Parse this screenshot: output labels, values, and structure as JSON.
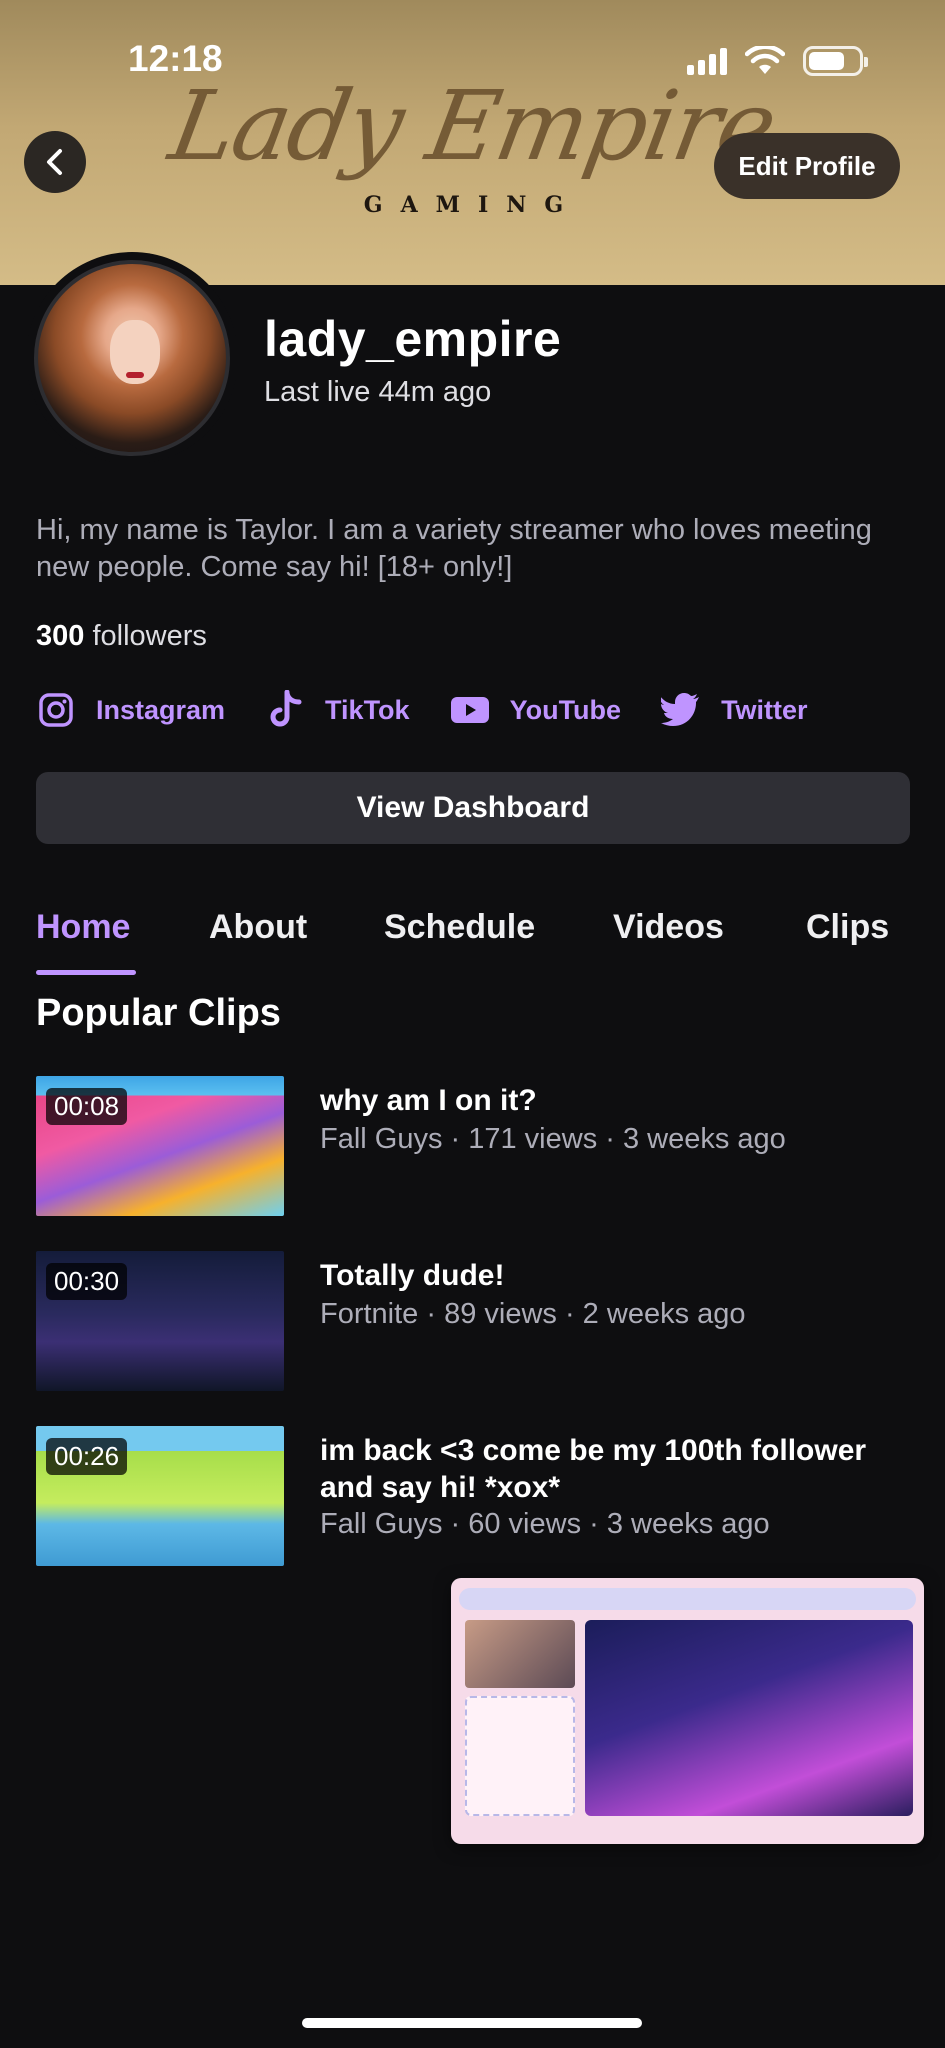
{
  "status_bar": {
    "time": "12:18",
    "battery_level": 0.72
  },
  "banner": {
    "logo_script": "Lady Empire",
    "logo_sub": "GAMING"
  },
  "nav": {
    "back_icon": "chevron-left-icon",
    "edit_profile_label": "Edit Profile"
  },
  "profile": {
    "username": "lady_empire",
    "last_live": "Last live 44m ago",
    "bio": "Hi, my name is Taylor. I am a variety streamer who loves meeting new people.  Come say hi!  [18+ only!]",
    "followers_count": "300",
    "followers_label": "followers"
  },
  "socials": [
    {
      "name": "Instagram",
      "icon": "instagram-icon"
    },
    {
      "name": "TikTok",
      "icon": "tiktok-icon"
    },
    {
      "name": "YouTube",
      "icon": "youtube-icon"
    },
    {
      "name": "Twitter",
      "icon": "twitter-icon"
    }
  ],
  "dashboard_button_label": "View Dashboard",
  "tabs": [
    {
      "label": "Home",
      "active": true
    },
    {
      "label": "About",
      "active": false
    },
    {
      "label": "Schedule",
      "active": false
    },
    {
      "label": "Videos",
      "active": false
    },
    {
      "label": "Clips",
      "active": false
    }
  ],
  "section_title": "Popular Clips",
  "clips": [
    {
      "duration": "00:08",
      "title": "why am I on it?",
      "meta": "Fall Guys · 171 views · 3 weeks ago"
    },
    {
      "duration": "00:30",
      "title": "Totally dude!",
      "meta": "Fortnite · 89 views · 2 weeks ago"
    },
    {
      "duration": "00:26",
      "title": "im back <3 come be my 100th follower and say hi! *xox*",
      "meta": "Fall Guys · 60 views · 3 weeks ago"
    }
  ],
  "colors": {
    "accent": "#bf94ff",
    "background": "#0e0e10",
    "banner": "#c2a874"
  }
}
